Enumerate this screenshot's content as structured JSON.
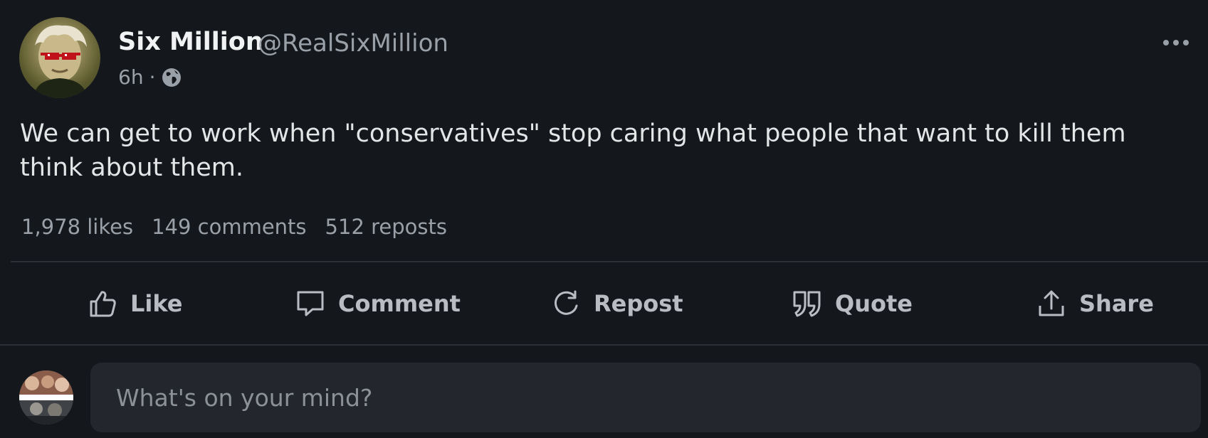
{
  "post": {
    "author": {
      "name": "Six Million",
      "handle": "@RealSixMillion",
      "avatar_icon": "avatar-portrait-with-pixel-sunglasses"
    },
    "meta": {
      "time": "6h",
      "separator": "·",
      "visibility_icon": "globe-icon"
    },
    "more_icon": "more-horizontal-icon",
    "text": "We can get to work when \"conservatives\" stop caring what people that want to kill them think about them.",
    "stats": {
      "likes": "1,978 likes",
      "comments": "149 comments",
      "reposts": "512 reposts"
    },
    "actions": [
      {
        "label": "Like",
        "icon": "thumbs-up-icon"
      },
      {
        "label": "Comment",
        "icon": "comment-icon"
      },
      {
        "label": "Repost",
        "icon": "repost-icon"
      },
      {
        "label": "Quote",
        "icon": "quote-icon"
      },
      {
        "label": "Share",
        "icon": "share-icon"
      }
    ]
  },
  "composer": {
    "placeholder": "What's on your mind?",
    "avatar_icon": "user-avatar"
  },
  "colors": {
    "background": "#14171c",
    "divider": "#2c3036",
    "muted_text": "#9aa0a8",
    "input_background": "#23262d"
  }
}
